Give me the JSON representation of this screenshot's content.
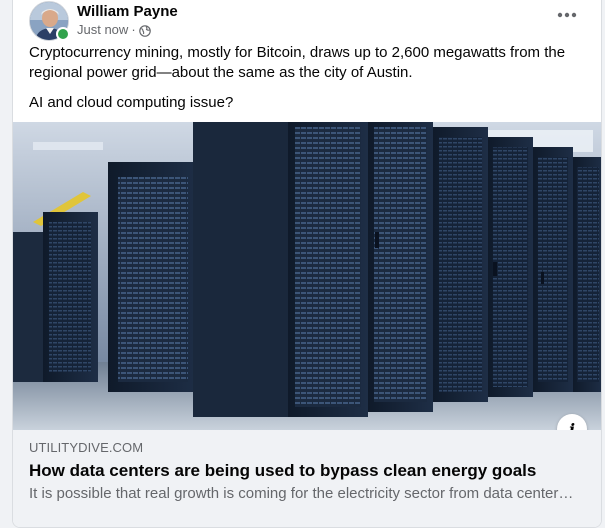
{
  "post": {
    "author": "William Payne",
    "timestamp": "Just now",
    "separator": "·",
    "privacy_icon": "globe-icon",
    "more_icon": "more-options-icon",
    "text_line_1": "Cryptocurrency mining, mostly for Bitcoin, draws up to 2,600 megawatts from the regional power grid—about the same as the city of Austin.",
    "text_line_2": "AI and cloud computing issue?"
  },
  "link": {
    "image_subject": "server-racks-photo",
    "domain": "UTILITYDIVE.COM",
    "title": "How data centers are being used to bypass clean energy goals",
    "description": "It is possible that real growth is coming for the electricity sector from data centers, AI and cloud computing.",
    "info_label": "i"
  },
  "colors": {
    "online": "#31a24c",
    "secondary_text": "#65676b",
    "primary_text": "#050505",
    "link_bg": "#f0f2f5"
  }
}
